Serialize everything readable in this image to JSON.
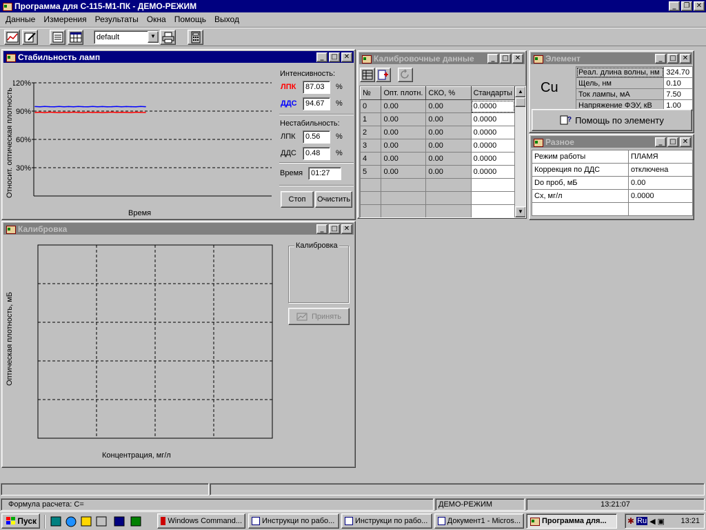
{
  "app": {
    "title": "Программа для С-115-М1-ПК - ДЕМО-РЕЖИМ"
  },
  "menu": [
    "Данные",
    "Измерения",
    "Результаты",
    "Окна",
    "Помощь",
    "Выход"
  ],
  "toolbar": {
    "method_select": "default"
  },
  "stability": {
    "title": "Стабильность ламп",
    "intensity_label": "Интенсивность:",
    "lpk_label": "ЛПК",
    "lpk_value": "87.03",
    "dds_label": "ДДС",
    "dds_value": "94.67",
    "pct": "%",
    "instability_label": "Нестабильность:",
    "lpk_inst_value": "0.56",
    "dds_inst_value": "0.48",
    "time_label": "Время",
    "time_value": "01:27",
    "stop_button": "Стоп",
    "clear_button": "Очистить",
    "ylabel": "Относит. оптическая плотность",
    "xlabel": "Время",
    "colors": {
      "lpk": "#ff0000",
      "dds": "#0000ff"
    }
  },
  "chart_data": {
    "type": "line",
    "title": "",
    "xlabel": "Время",
    "ylabel": "Относит. оптическая плотность",
    "ytick_labels": [
      "120%",
      "90%",
      "60%",
      "30%"
    ],
    "ylim": [
      0,
      120
    ],
    "grid": true,
    "series": [
      {
        "name": "ЛПК",
        "color": "#ff0000",
        "values": [
          88.5,
          88.8,
          88.3,
          88.9,
          88.6,
          88.4,
          88.7,
          88.5,
          88.9,
          88.6,
          88.3,
          88.8,
          88.5,
          88.7,
          88.4,
          88.6,
          88.9,
          88.5,
          88.7,
          88.6,
          88.4,
          88.8,
          88.6,
          88.5
        ]
      },
      {
        "name": "ДДС",
        "color": "#0000ff",
        "values": [
          94.8,
          94.6,
          95.0,
          94.7,
          94.5,
          94.9,
          94.6,
          94.8,
          94.5,
          94.9,
          94.7,
          94.6,
          94.9,
          94.6,
          94.8,
          94.5,
          94.7,
          95.0,
          94.6,
          94.8,
          94.7,
          94.5,
          94.9,
          94.7
        ]
      }
    ]
  },
  "calibration": {
    "title": "Калибровка",
    "group_label": "Калибровка",
    "accept_button": "Принять",
    "ylabel": "Оптическая плотность, мБ",
    "xlabel": "Концентрация, мг/л"
  },
  "caldata": {
    "title": "Калибровочные данные",
    "headers": [
      "№",
      "Опт. плотн.",
      "СКО, %",
      "Стандарты"
    ],
    "rows": [
      [
        "0",
        "0.00",
        "0.00",
        "0.0000"
      ],
      [
        "1",
        "0.00",
        "0.00",
        "0.0000"
      ],
      [
        "2",
        "0.00",
        "0.00",
        "0.0000"
      ],
      [
        "3",
        "0.00",
        "0.00",
        "0.0000"
      ],
      [
        "4",
        "0.00",
        "0.00",
        "0.0000"
      ],
      [
        "5",
        "0.00",
        "0.00",
        "0.0000"
      ]
    ]
  },
  "element": {
    "title": "Элемент",
    "symbol": "Cu",
    "props": [
      {
        "label": "Реал. длина волны, нм",
        "value": "324.70"
      },
      {
        "label": "Щель, нм",
        "value": "0.10"
      },
      {
        "label": "Ток лампы, мА",
        "value": "7.50"
      },
      {
        "label": "Напряжение ФЭУ, кВ",
        "value": "1.00"
      }
    ],
    "help_button": "Помощь по элементу"
  },
  "misc": {
    "title": "Разное",
    "rows": [
      {
        "label": "Режим работы",
        "value": "ПЛАМЯ"
      },
      {
        "label": "Коррекция по ДДС",
        "value": "отключена"
      },
      {
        "label": "Do проб, мБ",
        "value": "0.00"
      },
      {
        "label": "Сх, мг/л",
        "value": "0.0000"
      }
    ]
  },
  "statusbar": {
    "formula": "Формула расчета: С=",
    "mode": "ДЕМО-РЕЖИМ",
    "time": "13:21:07"
  },
  "taskbar": {
    "start": "Пуск",
    "tasks": [
      "Windows Command...",
      "Инструкци по рабо...",
      "Инструкци по рабо...",
      "Документ1 - Micros...",
      "Программа для..."
    ],
    "lang": "Ru",
    "clock": "13:21"
  }
}
